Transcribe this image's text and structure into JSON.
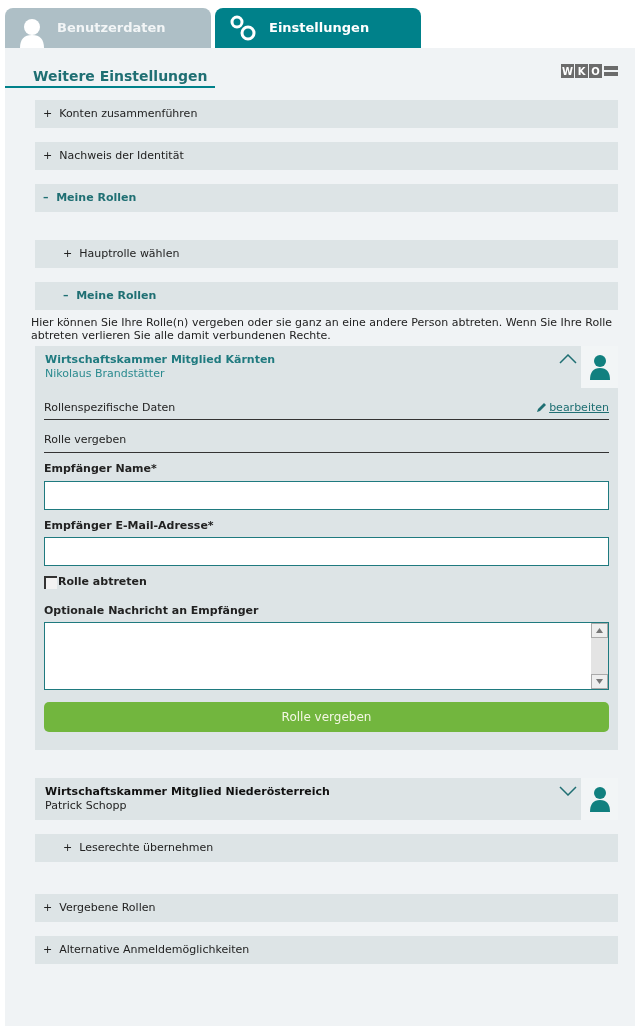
{
  "tabs": [
    {
      "label": "Benutzerdaten",
      "selected": false
    },
    {
      "label": "Einstellungen",
      "selected": true
    }
  ],
  "heading": "Weitere Einstellungen",
  "logo": {
    "letters": [
      "W",
      "K",
      "O"
    ]
  },
  "sections": [
    {
      "sign": "+",
      "label": "Konten zusammenführen",
      "expanded": false
    },
    {
      "sign": "+",
      "label": "Nachweis der Identität",
      "expanded": false
    },
    {
      "sign": "–",
      "label": "Meine Rollen",
      "expanded": true,
      "children": [
        {
          "sign": "+",
          "label": "Hauptrolle wählen",
          "expanded": false
        },
        {
          "sign": "–",
          "label": "Meine Rollen",
          "expanded": true,
          "intro": "Hier können Sie Ihre Rolle(n) vergeben oder sie ganz an eine andere Person abtreten. Wenn Sie Ihre Rolle abtreten verlieren Sie alle damit verbundenen Rechte.",
          "roles": [
            {
              "title": "Wirtschaftskammer Mitglied Kärnten",
              "person": "Nikolaus Brandstätter",
              "expanded": true,
              "data_label": "Rollenspezifische Daten",
              "edit_link": "bearbeiten",
              "form_title": "Rolle vergeben",
              "fields": [
                {
                  "kind": "text",
                  "label": "Empfänger Name*"
                },
                {
                  "kind": "text",
                  "label": "Empfänger E-Mail-Adresse*"
                },
                {
                  "kind": "checkbox",
                  "label": "Rolle abtreten",
                  "checked": false
                },
                {
                  "kind": "textarea",
                  "label": "Optionale Nachricht an Empfänger"
                }
              ],
              "submit": "Rolle vergeben"
            },
            {
              "title": "Wirtschaftskammer Mitglied Niederösterreich",
              "person": "Patrick Schopp",
              "expanded": false
            }
          ]
        },
        {
          "sign": "+",
          "label": "Leserechte übernehmen",
          "expanded": false
        }
      ]
    },
    {
      "sign": "+",
      "label": "Vergebene Rollen",
      "expanded": false
    },
    {
      "sign": "+",
      "label": "Alternative Anmeldemöglichkeiten",
      "expanded": false
    }
  ]
}
